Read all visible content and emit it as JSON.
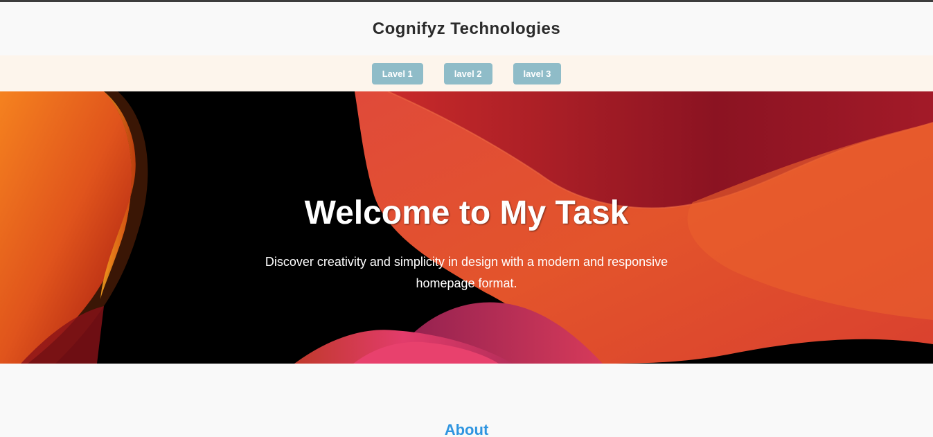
{
  "header": {
    "title": "Cognifyz Technologies"
  },
  "nav": {
    "items": [
      {
        "label": "Lavel 1"
      },
      {
        "label": "lavel 2"
      },
      {
        "label": "lavel 3"
      }
    ]
  },
  "hero": {
    "title": "Welcome to My Task",
    "subtitle": "Discover creativity and simplicity in design with a modern and responsive homepage format."
  },
  "about": {
    "title": "About"
  },
  "colors": {
    "nav_button": "#8fbcc8",
    "nav_background": "#fdf5ec",
    "about_title": "#2f95e0",
    "hero_background": "#000000"
  }
}
